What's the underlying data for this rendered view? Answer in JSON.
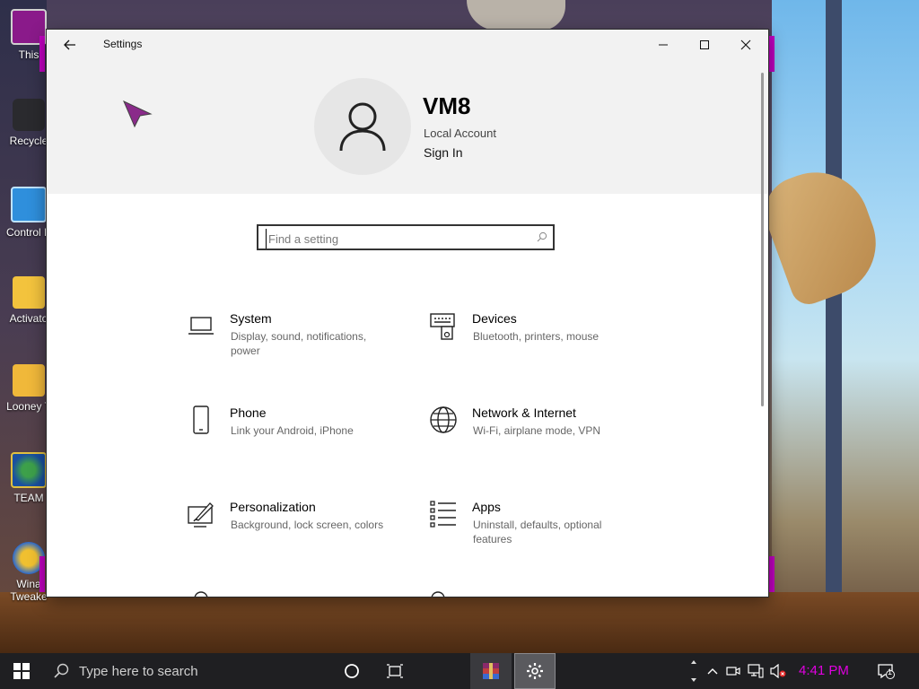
{
  "desktop": {
    "icons": [
      {
        "label": "This",
        "icon": "this-pc-icon"
      },
      {
        "label": "Recycle",
        "icon": "recycle-bin-icon"
      },
      {
        "label": "Control P",
        "icon": "control-panel-icon"
      },
      {
        "label": "Activato",
        "icon": "folder-icon"
      },
      {
        "label": "Looney T",
        "icon": "folder-icon"
      },
      {
        "label": "TEAM",
        "icon": "globe-icon"
      },
      {
        "label": "Wina",
        "label2": "Tweake",
        "icon": "winaero-icon"
      }
    ]
  },
  "window": {
    "title": "Settings",
    "controls": {
      "minimize": "minimize-icon",
      "maximize": "maximize-icon",
      "close": "close-icon"
    }
  },
  "account": {
    "name": "VM8",
    "type": "Local Account",
    "sign_in": "Sign In"
  },
  "search": {
    "placeholder": "Find a setting"
  },
  "categories": [
    {
      "name": "System",
      "desc": "Display, sound, notifications, power",
      "icon": "laptop-icon"
    },
    {
      "name": "Devices",
      "desc": "Bluetooth, printers, mouse",
      "icon": "devices-icon"
    },
    {
      "name": "Phone",
      "desc": "Link your Android, iPhone",
      "icon": "phone-icon"
    },
    {
      "name": "Network & Internet",
      "desc": "Wi-Fi, airplane mode, VPN",
      "icon": "globe-icon"
    },
    {
      "name": "Personalization",
      "desc": "Background, lock screen, colors",
      "icon": "paintbrush-icon"
    },
    {
      "name": "Apps",
      "desc": "Uninstall, defaults, optional features",
      "icon": "apps-list-icon"
    }
  ],
  "taskbar": {
    "search_placeholder": "Type here to search",
    "time": "4:41 PM",
    "notification_count": "1"
  },
  "colors": {
    "accent_purple": "#c000c0",
    "clock_color": "#e000e0",
    "taskbar_bg": "#1f1f22"
  }
}
